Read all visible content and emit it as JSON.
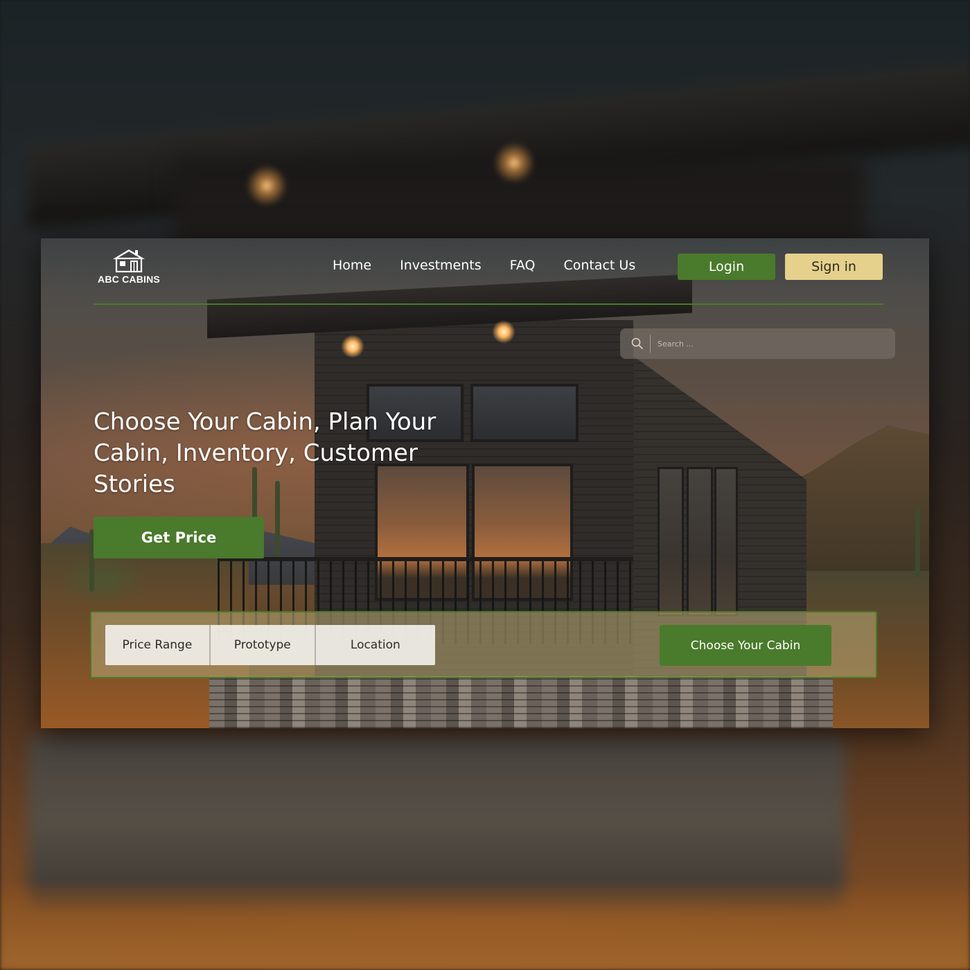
{
  "brand": {
    "name": "ABC CABINS",
    "logo_icon": "cabin-house-icon"
  },
  "nav": {
    "links": [
      "Home",
      "Investments",
      "FAQ",
      "Contact Us"
    ],
    "login_label": "Login",
    "signin_label": "Sign in"
  },
  "search": {
    "placeholder": "Search ...",
    "icon": "search-icon"
  },
  "hero": {
    "title": "Choose Your Cabin, Plan Your Cabin, Inventory, Customer Stories",
    "cta_label": "Get Price"
  },
  "filters": {
    "items": [
      "Price Range",
      "Prototype",
      "Location"
    ],
    "submit_label": "Choose Your Cabin"
  },
  "colors": {
    "accent_green": "#4a7a2c",
    "accent_gold": "#e5d18c",
    "divider_green": "#4b7a27"
  }
}
